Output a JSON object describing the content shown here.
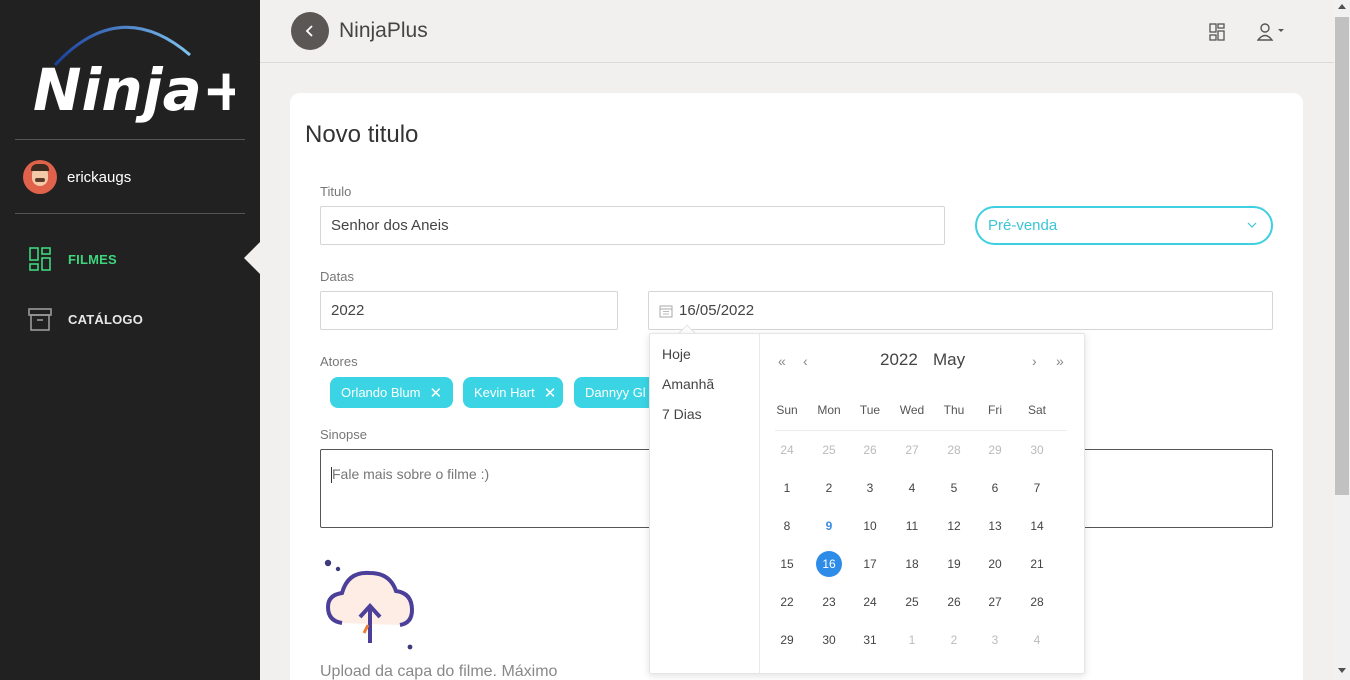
{
  "sidebar": {
    "logo_text": "Ninja+",
    "user_name": "erickaugs",
    "nav": [
      {
        "label": "FILMES",
        "icon": "grid-icon",
        "active": true
      },
      {
        "label": "CATÁLOGO",
        "icon": "archive-icon",
        "active": false
      }
    ]
  },
  "topbar": {
    "title": "NinjaPlus",
    "icons": [
      "back-icon",
      "grid-icon",
      "user-icon"
    ]
  },
  "form": {
    "heading": "Novo titulo",
    "titulo_label": "Titulo",
    "titulo_value": "Senhor dos Aneis",
    "status_value": "Pré-venda",
    "datas_label": "Datas",
    "year_value": "2022",
    "date_value": "16/05/2022",
    "atores_label": "Atores",
    "actors": [
      "Orlando Blum",
      "Kevin Hart",
      "Dannyy Gl"
    ],
    "sinopse_label": "Sinopse",
    "sinopse_placeholder": "Fale mais sobre o filme :)",
    "upload_text": "Upload da capa do filme. Máximo"
  },
  "datepicker": {
    "presets": [
      "Hoje",
      "Amanhã",
      "7 Dias"
    ],
    "year": "2022",
    "month": "May",
    "nav": {
      "prev_year": "«",
      "prev_month": "‹",
      "next_month": "›",
      "next_year": "»"
    },
    "weekdays": [
      "Sun",
      "Mon",
      "Tue",
      "Wed",
      "Thu",
      "Fri",
      "Sat"
    ],
    "weeks": [
      [
        "24",
        "25",
        "26",
        "27",
        "28",
        "29",
        "30"
      ],
      [
        "1",
        "2",
        "3",
        "4",
        "5",
        "6",
        "7"
      ],
      [
        "8",
        "9",
        "10",
        "11",
        "12",
        "13",
        "14"
      ],
      [
        "15",
        "16",
        "17",
        "18",
        "19",
        "20",
        "21"
      ],
      [
        "22",
        "23",
        "24",
        "25",
        "26",
        "27",
        "28"
      ],
      [
        "29",
        "30",
        "31",
        "1",
        "2",
        "3",
        "4"
      ]
    ],
    "today": "9",
    "selected": "16",
    "colors": {
      "selected": "#2d8ce8",
      "accent": "#3ed0e0",
      "active_nav": "#3ed57e"
    }
  }
}
